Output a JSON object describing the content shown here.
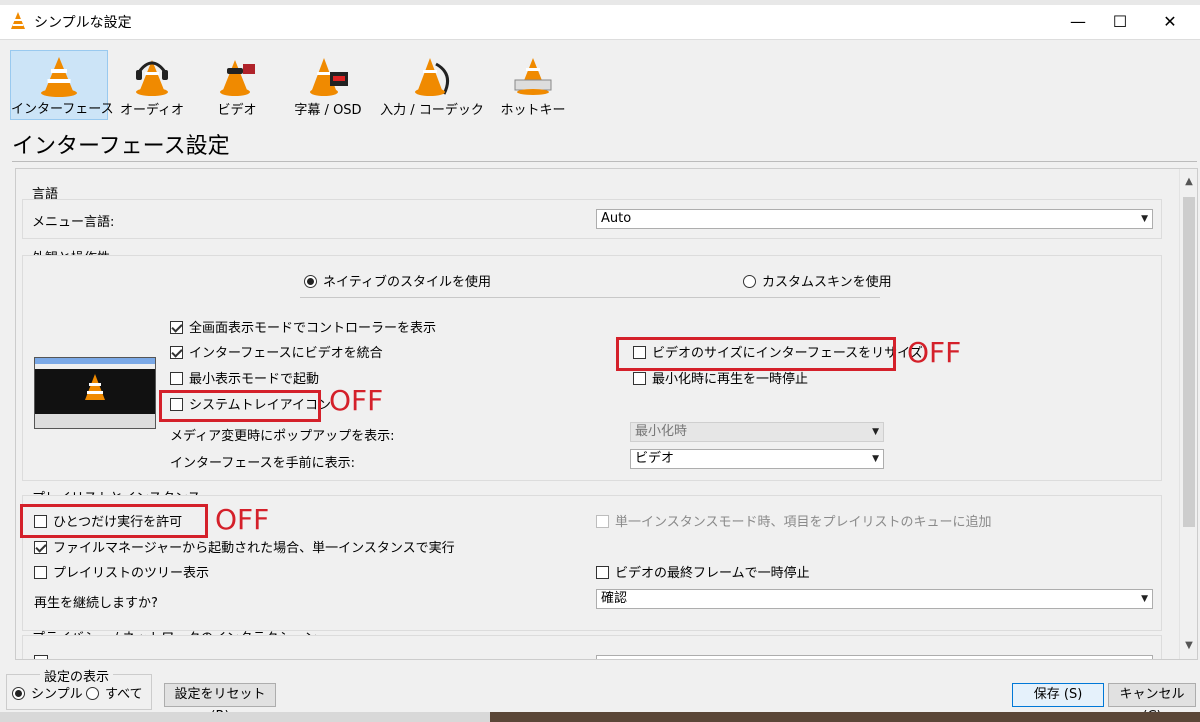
{
  "window": {
    "title": "シンプルな設定",
    "minimize_glyph": "—",
    "maximize_glyph": "☐",
    "close_glyph": "✕"
  },
  "toolbar": {
    "items": [
      {
        "label": "インターフェース",
        "icon": "vlc-cone-icon",
        "active": true
      },
      {
        "label": "オーディオ",
        "icon": "headphones-cone-icon",
        "active": false
      },
      {
        "label": "ビデオ",
        "icon": "glasses-cone-icon",
        "active": false
      },
      {
        "label": "字幕 / OSD",
        "icon": "clock-cone-icon",
        "active": false
      },
      {
        "label": "入力 / コーデック",
        "icon": "cable-cone-icon",
        "active": false
      },
      {
        "label": "ホットキー",
        "icon": "keyboard-cone-icon",
        "active": false
      }
    ]
  },
  "page": {
    "title": "インターフェース設定"
  },
  "language": {
    "group": "言語",
    "menu_language_label": "メニュー言語:",
    "menu_language_value": "Auto"
  },
  "appearance": {
    "group": "外観と操作性",
    "native_style": "ネイティブのスタイルを使用",
    "custom_skin": "カスタムスキンを使用",
    "fullscreen_controller": "全画面表示モードでコントローラーを表示",
    "embed_video": "インターフェースにビデオを統合",
    "start_minimal": "最小表示モードで起動",
    "systray": "システムトレイアイコン",
    "resize_to_video": "ビデオのサイズにインターフェースをリサイズ",
    "pause_minimized": "最小化時に再生を一時停止",
    "popup_label": "メディア変更時にポップアップを表示:",
    "popup_value": "最小化時",
    "raise_label": "インターフェースを手前に表示:",
    "raise_value": "ビデオ"
  },
  "playlist": {
    "group": "プレイリストとインスタンス",
    "one_instance": "ひとつだけ実行を許可",
    "enqueue_single": "単一インスタンスモード時、項目をプレイリストのキューに追加",
    "file_manager_single": "ファイルマネージャーから起動された場合、単一インスタンスで実行",
    "tree_view": "プレイリストのツリー表示",
    "pause_last_frame": "ビデオの最終フレームで一時停止",
    "continue_label": "再生を継続しますか?",
    "continue_value": "確認"
  },
  "privacy": {
    "group": "プライバシー / ネットワークのインタラクション"
  },
  "annotations": {
    "off1": "OFF",
    "off2": "OFF",
    "off3": "OFF"
  },
  "bottom": {
    "show_settings_legend": "設定の表示",
    "simple": "シンプル",
    "all": "すべて",
    "reset": "設定をリセット (R)",
    "save": "保存 (S)",
    "cancel": "キャンセル (C)"
  },
  "colors": {
    "annotation_red": "#d4202a",
    "active_tab": "#cce4f7",
    "vlc_orange": "#f08a00"
  }
}
